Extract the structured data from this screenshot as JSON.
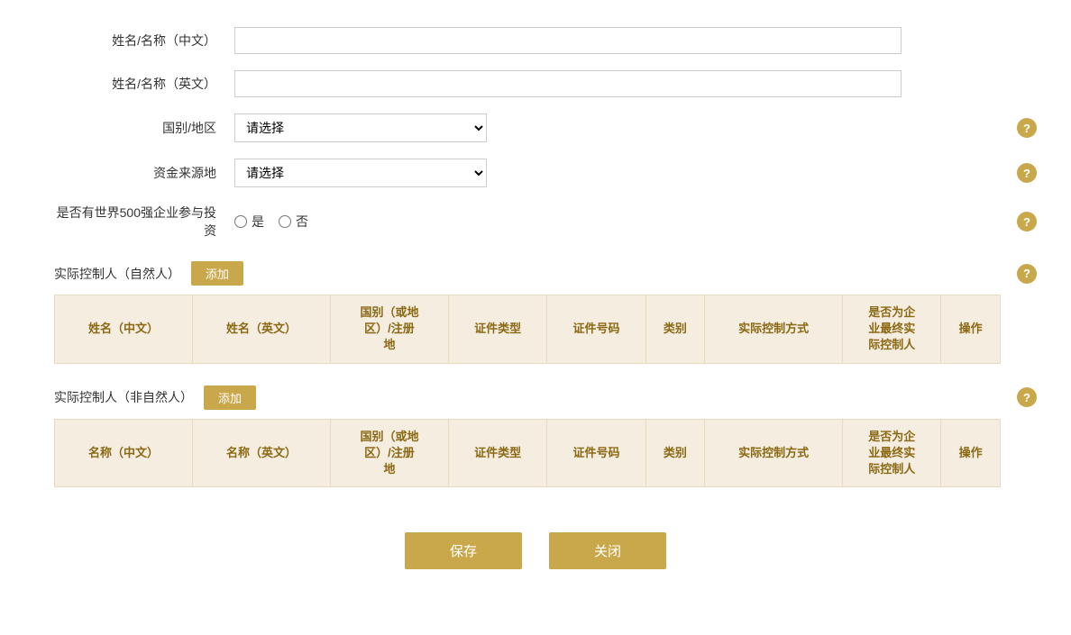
{
  "form": {
    "fields": {
      "name_cn_label": "姓名/名称（中文）",
      "name_en_label": "姓名/名称（英文）",
      "country_label": "国别/地区",
      "country_placeholder": "请选择",
      "fund_source_label": "资金来源地",
      "fund_source_placeholder": "请选择",
      "world500_label": "是否有世界500强企业参与投资",
      "world500_yes": "是",
      "world500_no": "否"
    },
    "section1": {
      "title": "实际控制人（自然人）",
      "add_btn": "添加",
      "columns": [
        "姓名（中文）",
        "姓名（英文）",
        "国别（或地区）/注册地",
        "证件类型",
        "证件号码",
        "类别",
        "实际控制方式",
        "是否为企业最终实际控制人",
        "操作"
      ]
    },
    "section2": {
      "title": "实际控制人（非自然人）",
      "add_btn": "添加",
      "columns": [
        "名称（中文）",
        "名称（英文）",
        "国别（或地区）/注册地",
        "证件类型",
        "证件号码",
        "类别",
        "实际控制方式",
        "是否为企业最终实际控制人",
        "操作"
      ]
    },
    "buttons": {
      "save": "保存",
      "close": "关闭"
    },
    "help_icon": "?",
    "colors": {
      "gold": "#c9a84c",
      "table_header_bg": "#f5ede0",
      "table_header_text": "#8b6914"
    }
  }
}
